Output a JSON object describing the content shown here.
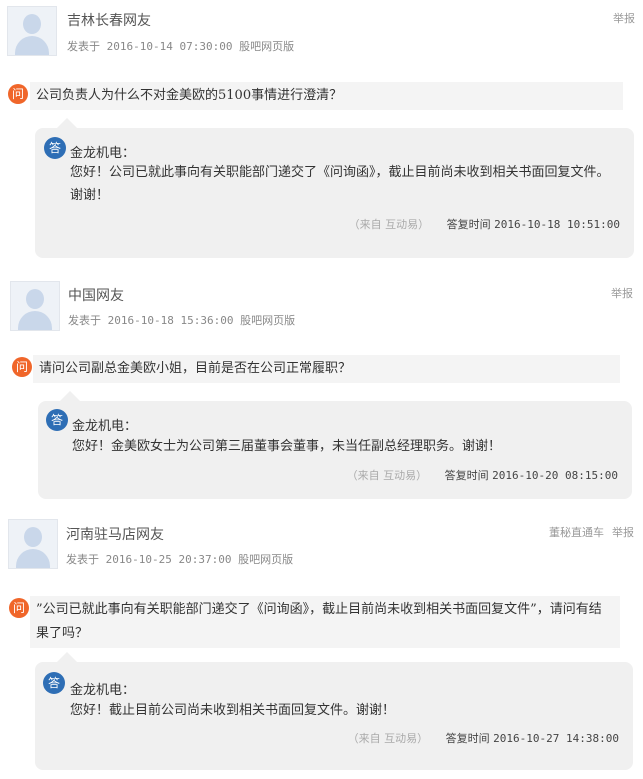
{
  "labels": {
    "report": "举报",
    "posted_prefix": "发表于",
    "q_icon": "问",
    "a_icon": "答",
    "from": "（来自 互动易）",
    "reply_time_label": "答复时间"
  },
  "posts": [
    {
      "user": "吉林长春网友",
      "posted_at": "2016-10-14 07:30:00",
      "source": "股吧网页版",
      "question": "公司负责人为什么不对金美欧的5100事情进行澄清？",
      "company": "金龙机电：",
      "answer": "您好！公司已就此事向有关职能部门递交了《问询函》，截止目前尚未收到相关书面回复文件。谢谢！",
      "reply_time": "2016-10-18 10:51:00"
    },
    {
      "user": "中国网友",
      "posted_at": "2016-10-18 15:36:00",
      "source": "股吧网页版",
      "question": "请问公司副总金美欧小姐，目前是否在公司正常履职？",
      "company": "金龙机电：",
      "answer": "您好！金美欧女士为公司第三届董事会董事，未当任副总经理职务。谢谢！",
      "reply_time": "2016-10-20 08:15:00"
    },
    {
      "user": "河南驻马店网友",
      "posted_at": "2016-10-25 20:37:00",
      "source": "股吧网页版",
      "tag": "董秘直通车",
      "question": "”公司已就此事向有关职能部门递交了《问询函》，截止目前尚未收到相关书面回复文件”，请问有结果了吗？",
      "company": "金龙机电：",
      "answer": "您好！截止目前公司尚未收到相关书面回复文件。谢谢！",
      "reply_time": "2016-10-27 14:38:00"
    }
  ]
}
